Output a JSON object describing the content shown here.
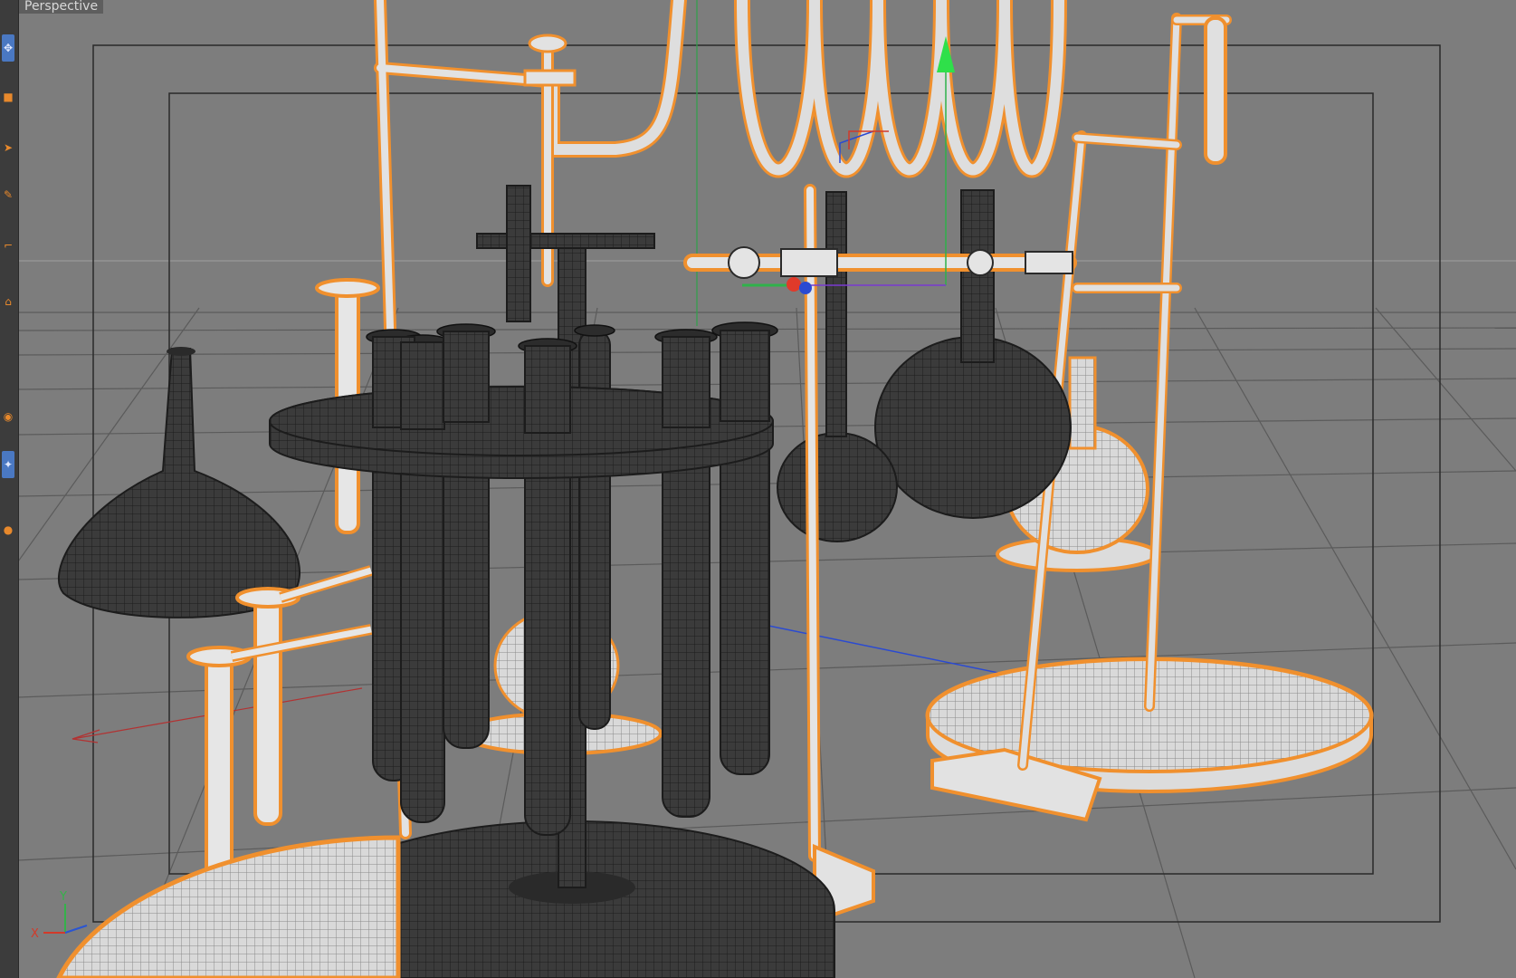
{
  "viewport": {
    "label": "Perspective"
  },
  "toolbar": {
    "tools": [
      {
        "name": "move-tool-icon",
        "glyph": "✥",
        "active": true
      },
      {
        "name": "cube-tool-icon",
        "glyph": "■",
        "active": false
      },
      {
        "name": "spline-tool-icon",
        "glyph": "➤",
        "active": false
      },
      {
        "name": "nurbs-tool-icon",
        "glyph": "✎",
        "active": false
      },
      {
        "name": "deformer-tool-icon",
        "glyph": "⌐",
        "active": false
      },
      {
        "name": "scene-tool-icon",
        "glyph": "⌂",
        "active": false
      },
      {
        "name": "camera-tool-icon",
        "glyph": "◉",
        "active": false
      },
      {
        "name": "light-tool-icon",
        "glyph": "✦",
        "active": true
      },
      {
        "name": "material-tool-icon",
        "glyph": "●",
        "active": false
      }
    ]
  },
  "axis_gizmo": {
    "x_label": "X",
    "y_label": "Y",
    "x_color": "#d23a2a",
    "y_color": "#35b24a",
    "z_color": "#2a55d2"
  },
  "colors": {
    "background": "#7d7d7d",
    "floor_grid": "#5b5b5b",
    "dark_mesh": "#3b3b3b",
    "mesh_wire": "#1c1c1c",
    "selected_mesh": "#e0e0e0",
    "selection_outline": "#f0902e",
    "safe_frame": "#2a2a2a"
  }
}
